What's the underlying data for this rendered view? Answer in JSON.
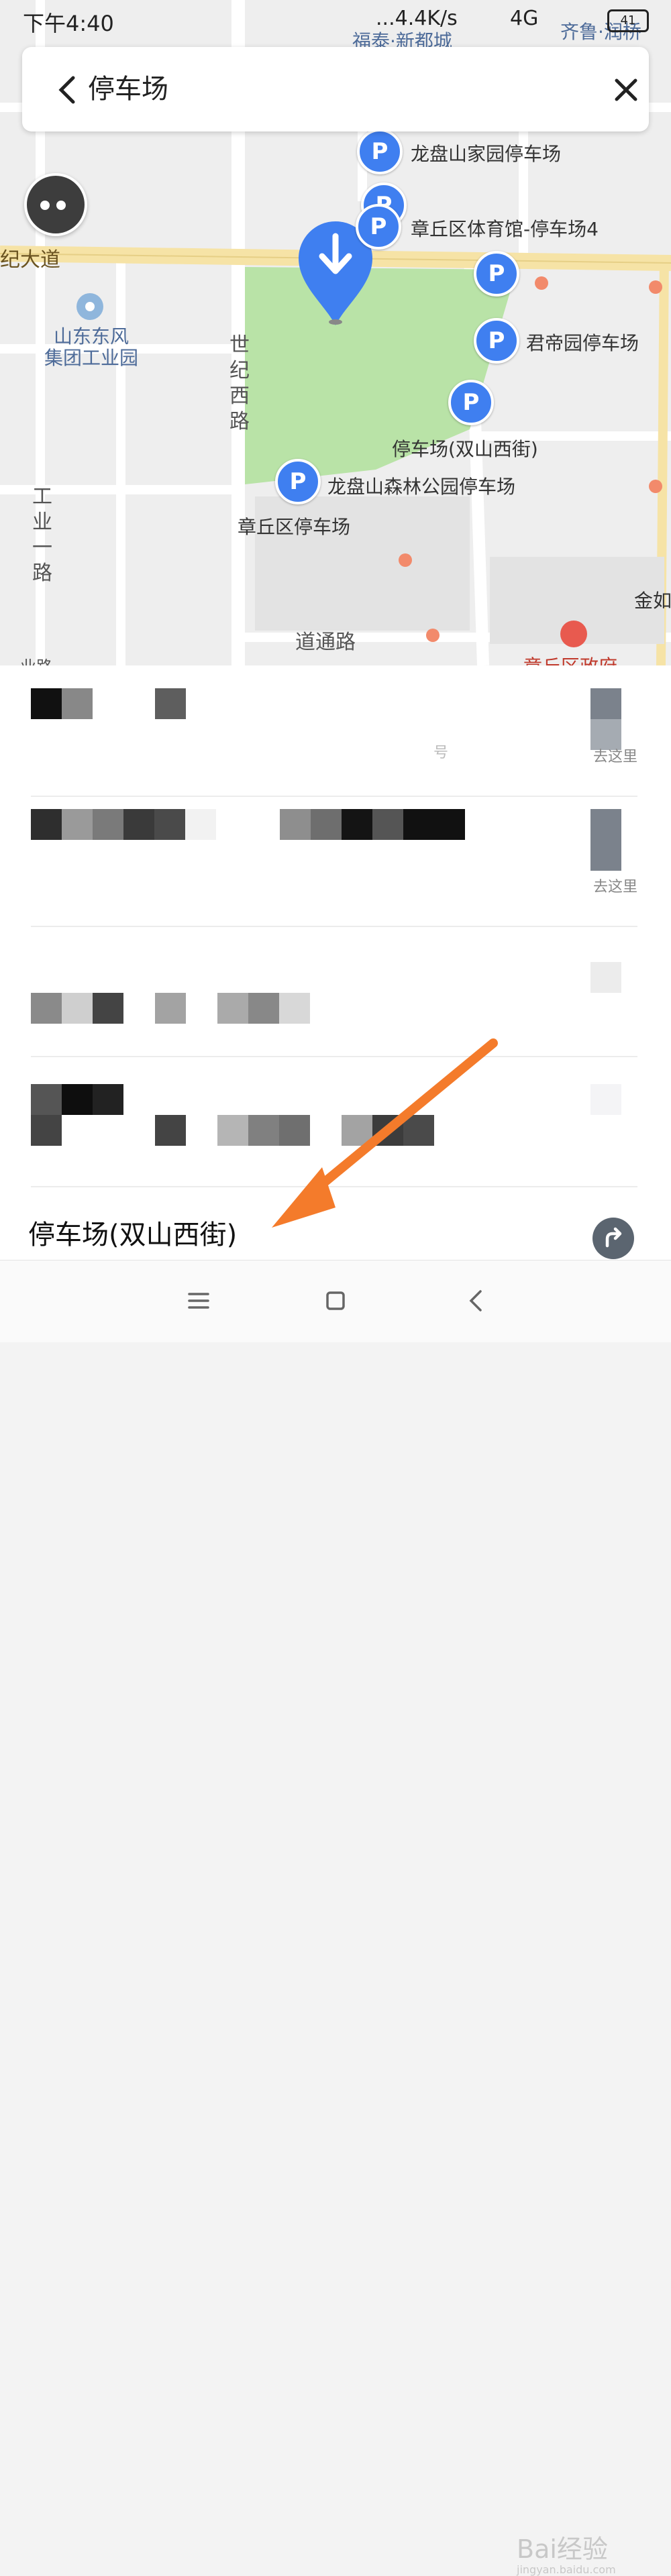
{
  "status_bar": {
    "time": "下午4:40",
    "network": "...4.4K/s",
    "signal": "4G",
    "battery": "41"
  },
  "search": {
    "query": "停车场"
  },
  "map": {
    "pois": {
      "top_area": "福泰·新都城",
      "top_right": "齐鲁·润桥",
      "park1": "龙盘山家园停车场",
      "park2": "章丘区体育馆-停车场4",
      "park3": "君帝园停车场",
      "park4": "停车场(双山西街)",
      "park5": "龙盘山森林公园停车场",
      "park6": "章丘区停车场",
      "company": "山东东风\n集团工业园",
      "gov": "章丘区政府",
      "partial_right": "金如"
    },
    "roads": {
      "main_road": "纪大道",
      "shiji_west": "世纪西路",
      "gongye_1": "工业一路",
      "daotong": "道通路",
      "partial_bottom_left": "业路"
    },
    "pin_letter": "P"
  },
  "results": [
    {
      "address_fragment": "号",
      "action": "去这里"
    },
    {
      "action": "去这里"
    },
    {},
    {},
    {
      "title": "停车场(双山西街)"
    }
  ],
  "navbar": {
    "icons": [
      "menu-icon",
      "home-square-icon",
      "back-chevron-icon"
    ]
  },
  "watermark": {
    "logo": "Bai经验",
    "url": "jingyan.baidu.com"
  },
  "colors": {
    "accent_blue": "#3f7ff0",
    "park_green": "#b9e3a7",
    "road_yellow": "#f6e3a6",
    "arrow_orange": "#f47b2b"
  }
}
